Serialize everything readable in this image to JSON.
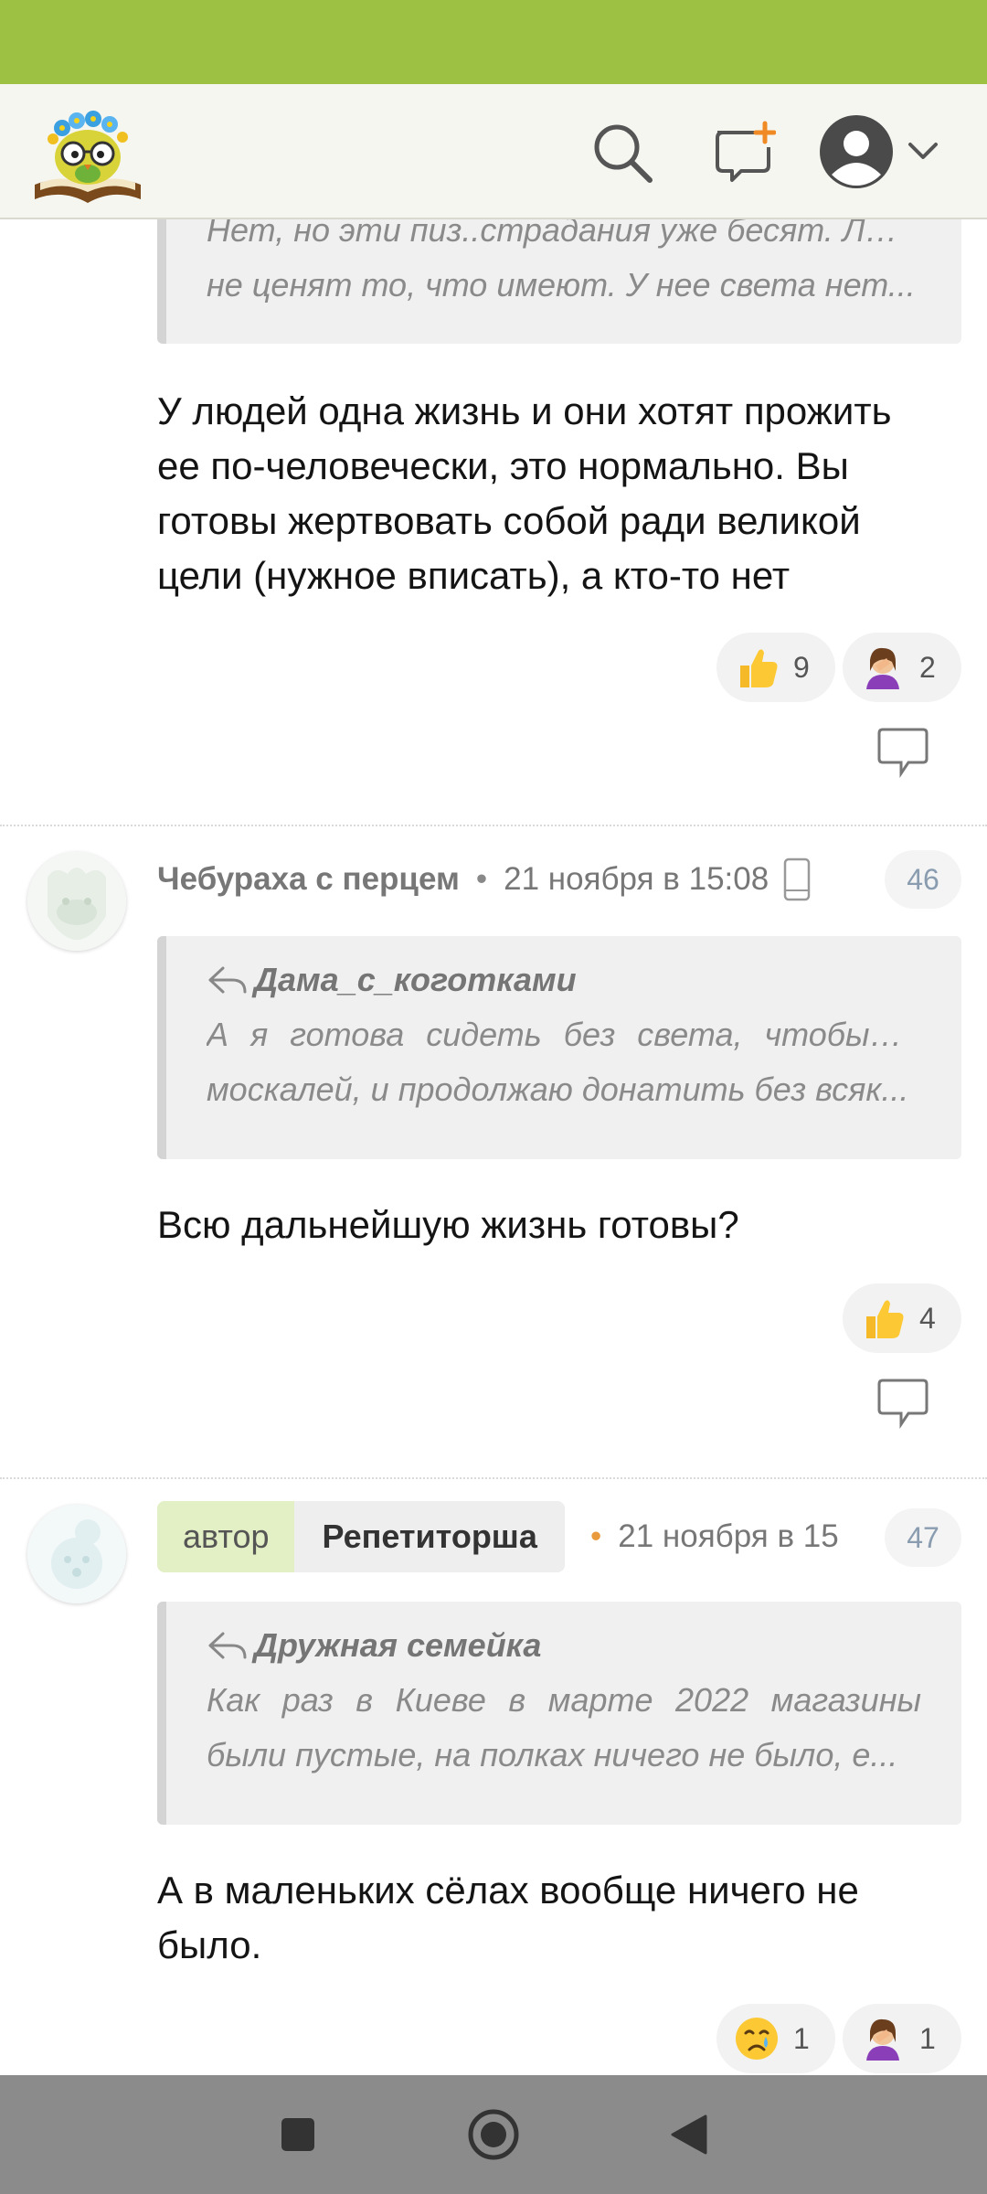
{
  "colors": {
    "status_bar": "#9dc243",
    "header_bg": "#f6f6f1",
    "author_tag_bg": "#e3efc4",
    "nav_bar": "#8b8b8b"
  },
  "header": {
    "logo_icon": "owl-on-book-logo",
    "search_icon": "search-icon",
    "new_post_icon": "new-post-icon",
    "profile_icon": "user-avatar-icon"
  },
  "comments": [
    {
      "quote": {
        "lines": [
          "Нет, но эти пиз..страдания уже бесят. Люди",
          "не ценят то, что имеют. У нее света нет..."
        ]
      },
      "text": [
        "У людей одна жизнь и они хотят прожить",
        "ее по-человечески, это нормально. Вы",
        "готовы жертвовать собой ради великой",
        "цели (нужное вписать), а кто-то нет"
      ],
      "reactions": [
        {
          "emoji": "thumbs-up",
          "count": "9"
        },
        {
          "emoji": "facepalm",
          "count": "2"
        }
      ]
    },
    {
      "user": "Чебураха с перцем",
      "dot": "•",
      "time": "21 ноября в 15:08",
      "device_icon": "mobile-phone-icon",
      "number": "46",
      "quote": {
        "author": "Дама_с_коготками",
        "lines": [
          "А я готова сидеть без света, чтобы без",
          "москалей, и продолжаю донатить без всяк..."
        ]
      },
      "text": [
        "Всю дальнейшую жизнь готовы?"
      ],
      "reactions": [
        {
          "emoji": "thumbs-up",
          "count": "4"
        }
      ]
    },
    {
      "author_label": "автор",
      "user": "Репетиторша",
      "dot": "•",
      "time": "21 ноября в 15",
      "number": "47",
      "quote": {
        "author": "Дружная семейка",
        "lines": [
          "Как раз в Киеве в марте 2022 магазины",
          "были пустые, на полках ничего не было, е..."
        ]
      },
      "text": [
        "А в маленьких сёлах вообще ничего не",
        "было."
      ],
      "reactions": [
        {
          "emoji": "crying-face",
          "count": "1"
        },
        {
          "emoji": "facepalm",
          "count": "1"
        }
      ]
    }
  ],
  "nav": {
    "recents_icon": "square-icon",
    "home_icon": "circle-home-icon",
    "back_icon": "triangle-back-icon"
  }
}
